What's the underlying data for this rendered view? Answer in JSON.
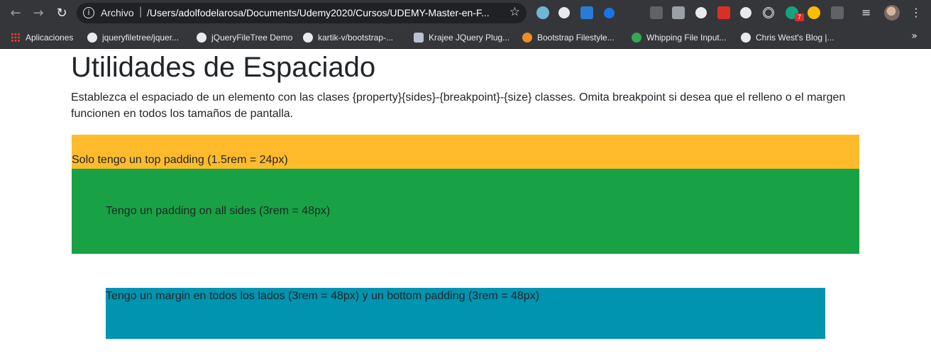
{
  "browser": {
    "omnibox": {
      "scheme_label": "Archivo",
      "url": "/Users/adolfodelarosa/Documents/Udemy2020/Cursos/UDEMY-Master-en-F..."
    },
    "extension_badge": "7",
    "bookmarks": [
      {
        "label": "Aplicaciones"
      },
      {
        "label": "jqueryfiletree/jquer..."
      },
      {
        "label": "jQueryFileTree Demo"
      },
      {
        "label": "kartik-v/bootstrap-..."
      },
      {
        "label": "Krajee JQuery Plug..."
      },
      {
        "label": "Bootstrap Filestyle..."
      },
      {
        "label": "Whipping File Input..."
      },
      {
        "label": "Chris West's Blog |..."
      }
    ],
    "overflow_label": "»"
  },
  "page": {
    "title": "Utilidades de Espaciado",
    "lead": "Establezca el espaciado de un elemento con las clases {property}{sides}-{breakpoint}-{size} classes. Omita breakpoint si desea que el relleno o el margen funcionen en todos los tamaños de pantalla.",
    "boxes": [
      {
        "text": "Solo tengo un top padding (1.5rem = 24px)",
        "color": "#ffbb2c"
      },
      {
        "text": "Tengo un padding on all sides (3rem = 48px)",
        "color": "#18a245"
      },
      {
        "text": "Tengo un margin en todos los lados (3rem = 48px) y un bottom padding (3rem = 48px)",
        "color": "#0094b0"
      }
    ]
  }
}
